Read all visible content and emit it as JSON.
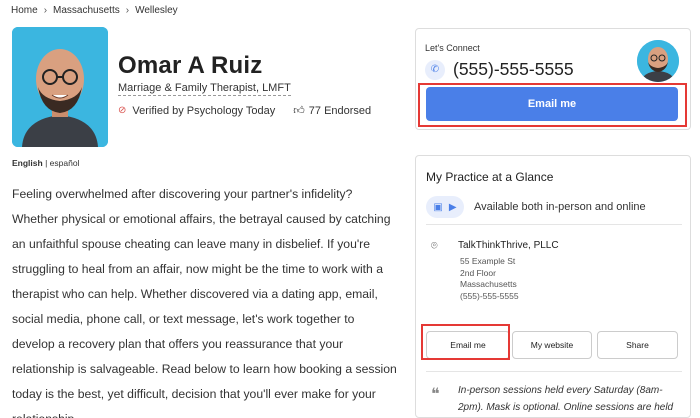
{
  "breadcrumb": [
    "Home",
    "Massachusetts",
    "Wellesley"
  ],
  "profile": {
    "name": "Omar A Ruiz",
    "title": "Marriage & Family Therapist, LMFT",
    "verified": "Verified by Psychology Today",
    "endorsed": "77 Endorsed",
    "languages_primary": "English",
    "languages_secondary": "español",
    "bio": "Feeling overwhelmed after discovering your partner's infidelity? Whether physical or emotional affairs, the betrayal caused by catching an unfaithful spouse cheating can leave many in disbelief. If you're struggling to heal from an affair, now might be the time to work with a therapist who can help. Whether discovered via a dating app, email, social media, phone call, or text message, let's work together to develop a recovery plan that offers you reassurance that your relationship is salvageable. Read below to learn how booking a session today is the best, yet difficult, decision that you'll ever make for your relationship."
  },
  "connect": {
    "label": "Let's Connect",
    "phone": "(555)-555-5555",
    "email_button": "Email me"
  },
  "glance": {
    "title": "My Practice at a Glance",
    "availability": "Available both in-person and online",
    "practice_name": "TalkThinkThrive, PLLC",
    "address_line1": "55 Example St",
    "address_line2": "2nd Floor",
    "address_line3": "Massachusetts",
    "address_phone": "(555)-555-5555",
    "email_button": "Email me",
    "website_button": "My website",
    "share_button": "Share",
    "note": "In-person sessions held every Saturday (8am-2pm). Mask is optional. Online sessions are held"
  },
  "colors": {
    "accent": "#4a7fe8",
    "highlight_box": "#e53935"
  }
}
